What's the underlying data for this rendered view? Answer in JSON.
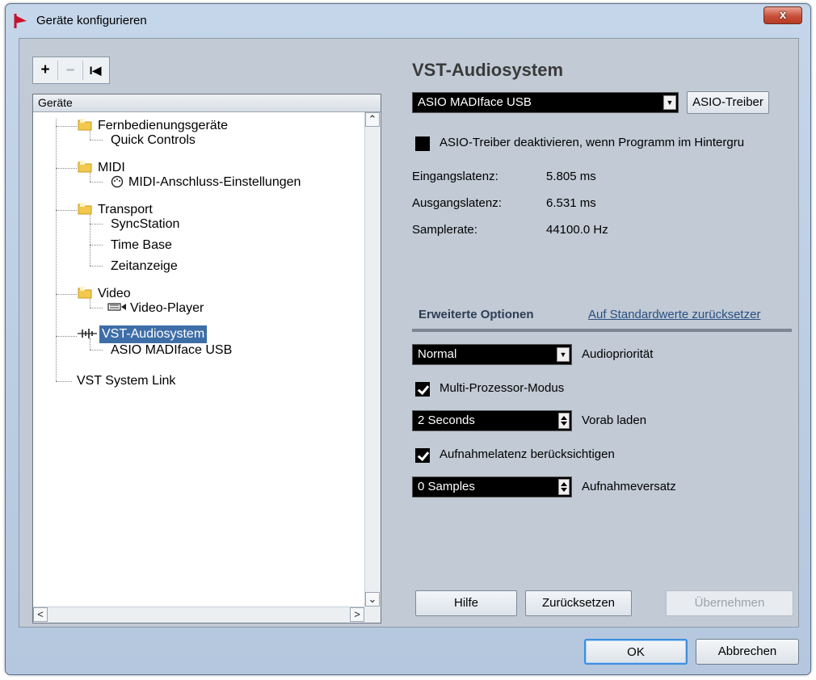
{
  "window": {
    "title": "Geräte konfigurieren",
    "close_label": "x"
  },
  "toolbar": {
    "add_label": "+",
    "remove_label": "–",
    "reset_label": "I◀"
  },
  "tree": {
    "header": "Geräte",
    "items": [
      {
        "label": "Fernbedienungsgeräte",
        "level": 1,
        "icon": "folder-icon"
      },
      {
        "label": "Quick Controls",
        "level": 2,
        "icon": ""
      },
      {
        "label": "MIDI",
        "level": 1,
        "icon": "folder-icon"
      },
      {
        "label": "MIDI-Anschluss-Einstellungen",
        "level": 2,
        "icon": "midi-port-icon"
      },
      {
        "label": "Transport",
        "level": 1,
        "icon": "folder-icon"
      },
      {
        "label": "SyncStation",
        "level": 2,
        "icon": ""
      },
      {
        "label": "Time Base",
        "level": 2,
        "icon": ""
      },
      {
        "label": "Zeitanzeige",
        "level": 2,
        "icon": ""
      },
      {
        "label": "Video",
        "level": 1,
        "icon": "folder-icon"
      },
      {
        "label": "Video-Player",
        "level": 2,
        "icon": "video-player-icon"
      },
      {
        "label": "VST-Audiosystem",
        "level": 1,
        "icon": "audio-icon",
        "selected": true
      },
      {
        "label": "ASIO MADIface USB",
        "level": 2,
        "icon": ""
      },
      {
        "label": "VST System Link",
        "level": 1,
        "icon": ""
      }
    ],
    "scroll_up": "⌃",
    "scroll_down": "⌄",
    "scroll_left": "<",
    "scroll_right": ">"
  },
  "panel": {
    "title": "VST-Audiosystem",
    "driver_select": "ASIO MADIface USB",
    "driver_button": "ASIO-Treiber",
    "deactivate_label": "ASIO-Treiber deaktivieren, wenn Programm im Hintergru",
    "deactivate_checked": false,
    "input_latency_label": "Eingangslatenz:",
    "input_latency_value": "5.805 ms",
    "output_latency_label": "Ausgangslatenz:",
    "output_latency_value": "6.531 ms",
    "samplerate_label": "Samplerate:",
    "samplerate_value": "44100.0 Hz",
    "advanced_tab": "Erweiterte Optionen",
    "reset_defaults_link": "Auf Standardwerte zurücksetzer",
    "priority_value": "Normal",
    "priority_label": "Audiopriorität",
    "multiproc_label": "Multi-Prozessor-Modus",
    "multiproc_checked": true,
    "preload_value": "2 Seconds",
    "preload_label": "Vorab laden",
    "rec_latency_label": "Aufnahmelatenz berücksichtigen",
    "rec_latency_checked": true,
    "rec_offset_value": "0 Samples",
    "rec_offset_label": "Aufnahmeversatz",
    "help_button": "Hilfe",
    "reset_button": "Zurücksetzen",
    "apply_button": "Übernehmen"
  },
  "footer": {
    "ok_button": "OK",
    "cancel_button": "Abbrechen"
  }
}
